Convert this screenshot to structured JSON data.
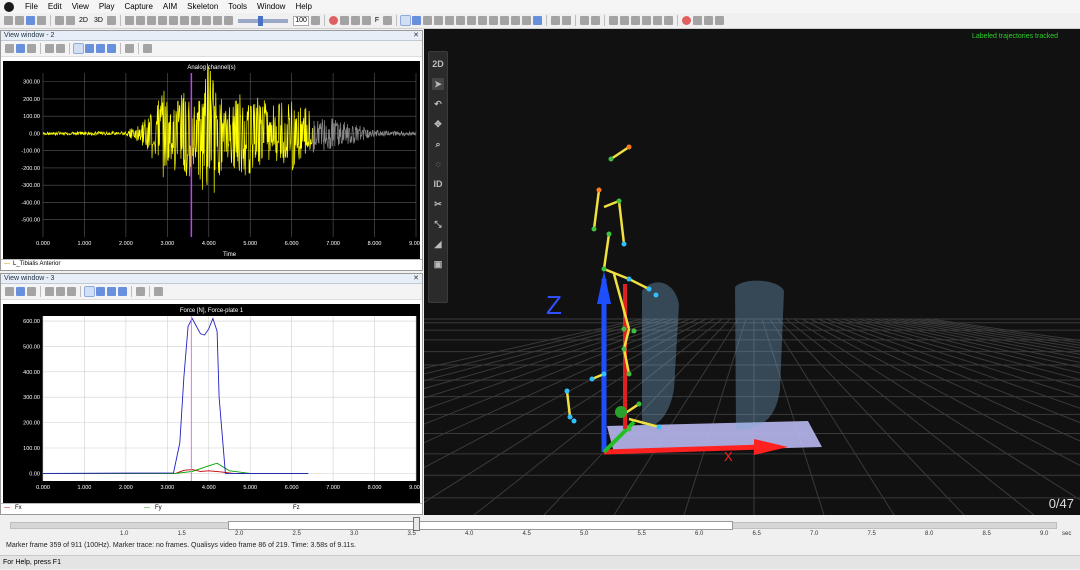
{
  "menu": [
    "File",
    "Edit",
    "View",
    "Play",
    "Capture",
    "AIM",
    "Skeleton",
    "Tools",
    "Window",
    "Help"
  ],
  "toolbar": {
    "mode_2d": "2D",
    "mode_3d": "3D",
    "zoom_value": "100",
    "f_label": "F"
  },
  "pane_top": {
    "title": "View window - 2",
    "chart_data": {
      "type": "line",
      "title": "Analog channel(s)",
      "xlabel": "Time",
      "xlim": [
        0,
        9
      ],
      "ylim": [
        -600,
        350
      ],
      "x_ticks": [
        "0.000",
        "1.000",
        "2.000",
        "3.000",
        "4.000",
        "5.000",
        "6.000",
        "7.000",
        "8.000",
        "9.000"
      ],
      "y_ticks": [
        "300.00",
        "200.00",
        "100.00",
        "0.00",
        "-100.00",
        "-200.00",
        "-300.00",
        "-400.00",
        "-500.00"
      ],
      "y_tick_values": [
        300,
        200,
        100,
        0,
        -100,
        -200,
        -300,
        -400,
        -500
      ],
      "series": [
        {
          "name": "L_Tibialis Anterior",
          "color": "#ffff00"
        }
      ],
      "envelope": [
        [
          0.0,
          10
        ],
        [
          2.0,
          12
        ],
        [
          2.5,
          90
        ],
        [
          2.9,
          260
        ],
        [
          3.1,
          200
        ],
        [
          3.4,
          280
        ],
        [
          3.7,
          230
        ],
        [
          4.0,
          450
        ],
        [
          4.4,
          140
        ],
        [
          4.8,
          260
        ],
        [
          5.3,
          200
        ],
        [
          5.6,
          160
        ],
        [
          6.0,
          220
        ],
        [
          6.2,
          190
        ],
        [
          6.5,
          110
        ],
        [
          7.0,
          90
        ],
        [
          7.5,
          60
        ],
        [
          8.0,
          20
        ],
        [
          9.0,
          12
        ]
      ],
      "cursor_x": 3.58,
      "cursor_color": "#c040ff"
    },
    "legend": "L_Tibialis Anterior"
  },
  "pane_bottom": {
    "title": "View window - 3",
    "chart_data": {
      "type": "line",
      "title": "Force [N], Force-plate 1",
      "xlim": [
        0,
        9
      ],
      "ylim": [
        -30,
        620
      ],
      "x_ticks": [
        "0.000",
        "1.000",
        "2.000",
        "3.000",
        "4.000",
        "5.000",
        "6.000",
        "7.000",
        "8.000",
        "9.000"
      ],
      "y_ticks": [
        "600.00",
        "500.00",
        "400.00",
        "300.00",
        "200.00",
        "100.00",
        "0.00"
      ],
      "y_tick_values": [
        600,
        500,
        400,
        300,
        200,
        100,
        0
      ],
      "series": [
        {
          "name": "Fx",
          "color": "#c00000",
          "x": [
            0,
            3.2,
            3.4,
            3.6,
            3.8,
            4.0,
            4.3,
            4.6,
            6.4
          ],
          "y": [
            0,
            0,
            12,
            15,
            8,
            10,
            6,
            0,
            0
          ]
        },
        {
          "name": "Fy",
          "color": "#00a000",
          "x": [
            0,
            3.2,
            3.6,
            4.0,
            4.2,
            4.5,
            5.0,
            6.4
          ],
          "y": [
            0,
            0,
            8,
            30,
            40,
            10,
            0,
            0
          ]
        },
        {
          "name": "Fz",
          "color": "#2020c0",
          "x": [
            0,
            3.15,
            3.3,
            3.4,
            3.5,
            3.6,
            3.8,
            3.9,
            4.0,
            4.1,
            4.2,
            4.25,
            4.4,
            6.4
          ],
          "y": [
            0,
            2,
            120,
            380,
            580,
            610,
            550,
            545,
            570,
            610,
            560,
            300,
            0,
            0
          ]
        }
      ],
      "cursor_x": 3.58,
      "cursor_color": "#ff60ff"
    },
    "legend": {
      "fx": "Fx",
      "fy": "Fy",
      "fz": "Fz"
    }
  },
  "scene": {
    "tools": [
      "2D",
      "select",
      "rotate",
      "translate",
      "zoom",
      "center",
      "ID",
      "cut",
      "link",
      "fill",
      "box"
    ],
    "tracked_label": "Labeled trajectories tracked",
    "counter": "0/47"
  },
  "timeline": {
    "ticks": [
      "1.0",
      "1.5",
      "2.0",
      "2.5",
      "3.0",
      "3.5",
      "4.0",
      "4.5",
      "5.0",
      "5.5",
      "6.0",
      "6.5",
      "7.0",
      "7.5",
      "8.0",
      "8.5",
      "9.0",
      "sec"
    ],
    "status": "Marker frame 359 of 911 (100Hz). Marker trace: no frames. Qualisys video frame 86 of 219. Time: 3.58s of 9.11s."
  },
  "statusbar": "For Help, press F1"
}
